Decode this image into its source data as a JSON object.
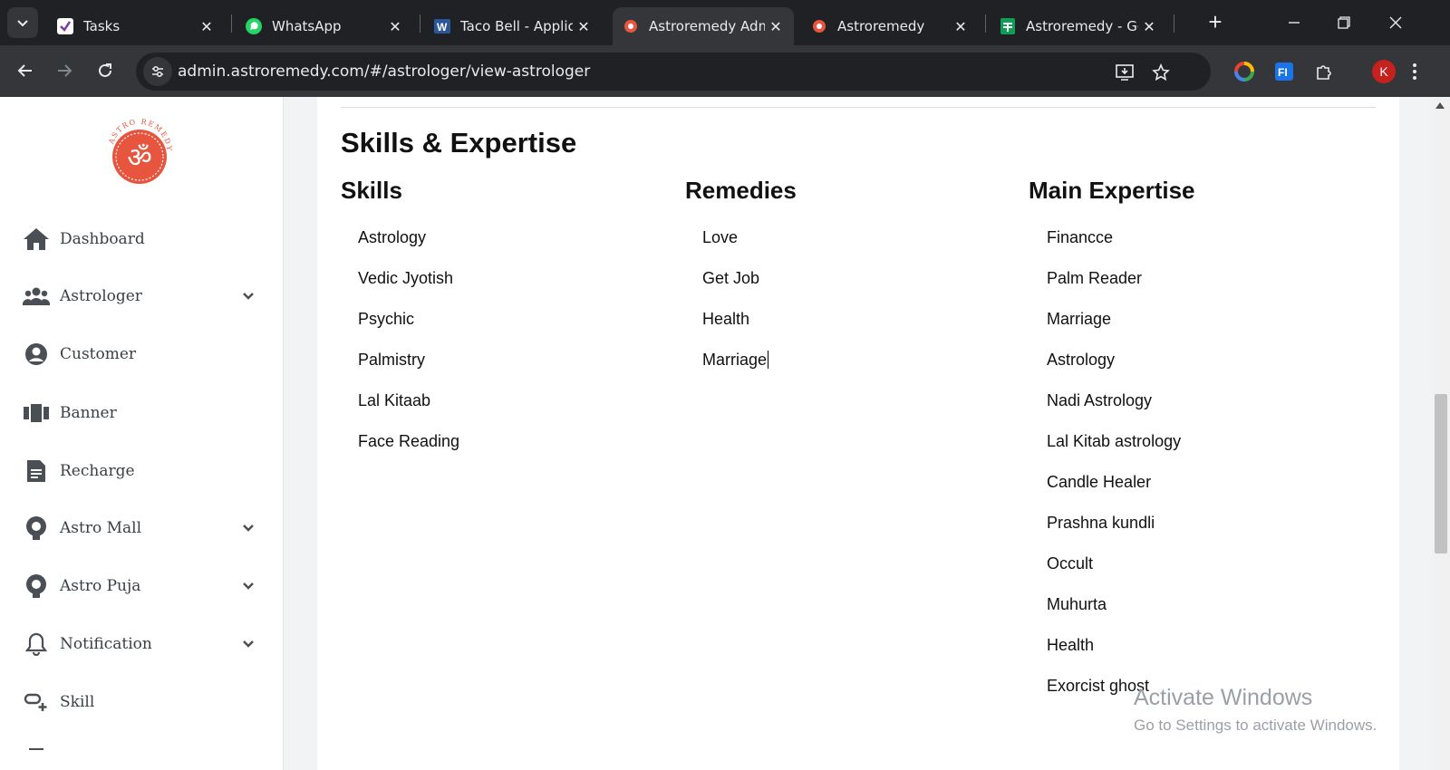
{
  "browser": {
    "tabs": [
      {
        "title": "Tasks",
        "icon": "tasks-icon"
      },
      {
        "title": "WhatsApp",
        "icon": "whatsapp-icon"
      },
      {
        "title": "Taco Bell - Applicat",
        "icon": "word-icon"
      },
      {
        "title": "Astroremedy Admi",
        "icon": "astroremedy-icon",
        "active": true
      },
      {
        "title": "Astroremedy",
        "icon": "astroremedy-icon"
      },
      {
        "title": "Astroremedy - Goo",
        "icon": "sheets-icon"
      }
    ],
    "url": "admin.astroremedy.com/#/astrologer/view-astrologer",
    "profile_initial": "K"
  },
  "sidebar": {
    "logo_text": "ASTRO REMEDY",
    "items": [
      {
        "label": "Dashboard",
        "icon": "home-icon",
        "expandable": false
      },
      {
        "label": "Astrologer",
        "icon": "users-icon",
        "expandable": true
      },
      {
        "label": "Customer",
        "icon": "user-circle-icon",
        "expandable": false
      },
      {
        "label": "Banner",
        "icon": "banner-icon",
        "expandable": false
      },
      {
        "label": "Recharge",
        "icon": "document-icon",
        "expandable": false
      },
      {
        "label": "Astro Mall",
        "icon": "bulb-icon",
        "expandable": true
      },
      {
        "label": "Astro Puja",
        "icon": "bulb-icon",
        "expandable": true
      },
      {
        "label": "Notification",
        "icon": "bell-icon",
        "expandable": true
      },
      {
        "label": "Skill",
        "icon": "skill-icon",
        "expandable": false
      }
    ]
  },
  "main": {
    "section_title": "Skills & Expertise",
    "skills": {
      "title": "Skills",
      "items": [
        "Astrology",
        "Vedic Jyotish",
        "Psychic",
        "Palmistry",
        "Lal Kitaab",
        "Face Reading"
      ]
    },
    "remedies": {
      "title": "Remedies",
      "items": [
        "Love",
        "Get Job",
        "Health",
        "Marriage"
      ]
    },
    "expertise": {
      "title": "Main Expertise",
      "items": [
        "Financce",
        "Palm Reader",
        "Marriage",
        "Astrology",
        "Nadi Astrology",
        "Lal Kitab astrology",
        "Candle Healer",
        "Prashna kundli",
        "Occult",
        "Muhurta",
        "Health",
        "Exorcist ghost"
      ]
    }
  },
  "watermark": {
    "line1": "Activate Windows",
    "line2": "Go to Settings to activate Windows."
  },
  "colors": {
    "brand_orange": "#e8553f",
    "chrome_dark": "#202124",
    "chrome_mid": "#35363a"
  }
}
